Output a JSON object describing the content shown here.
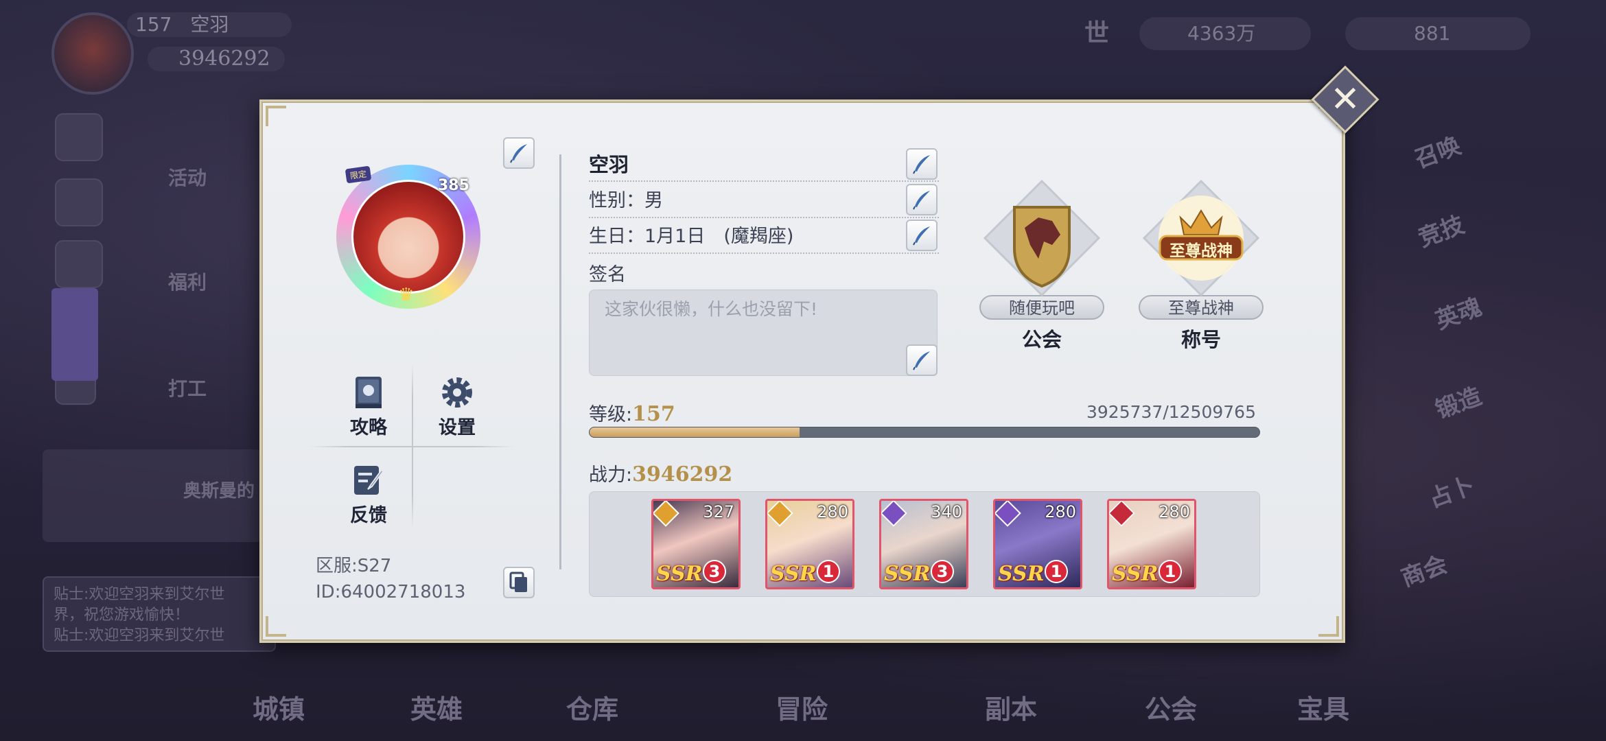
{
  "background": {
    "player_level": "157",
    "player_name": "空羽",
    "player_power": "3946292",
    "currency_gold": "4363万",
    "currency_gems": "881",
    "world_label": "世",
    "left_menu": [
      "活动",
      "福利",
      "打工"
    ],
    "right_menu": [
      "召唤",
      "竞技",
      "英魂",
      "锻造",
      "占卜",
      "商会"
    ],
    "bottom_nav": [
      "城镇",
      "英雄",
      "仓库",
      "冒险",
      "副本",
      "公会",
      "宝具"
    ],
    "notice_preview": "奥斯曼的",
    "chat_lines": [
      "贴士:欢迎空羽来到艾尔世",
      "界，祝您游戏愉快！",
      "贴士:欢迎空羽来到艾尔世"
    ]
  },
  "profile": {
    "avatar_level": "385",
    "avatar_tag": "限定",
    "name": "空羽",
    "gender": "性别：男",
    "birthday": "生日：1月1日　(魔羯座)",
    "signature_label": "签名",
    "signature_placeholder": "这家伙很懒，什么也没留下!",
    "menu": {
      "guide": "攻略",
      "settings": "设置",
      "feedback": "反馈"
    },
    "server": "区服:S27",
    "id": "ID:64002718013",
    "guild": {
      "name": "随便玩吧",
      "caption": "公会"
    },
    "title": {
      "name": "至尊战神",
      "caption": "称号",
      "emblem_text": "至尊战神"
    },
    "level_label": "等级:",
    "level": "157",
    "exp_text": "3925737/12509765",
    "exp_fraction": 0.3138,
    "power_label": "战力:",
    "power": "3946292",
    "team": [
      {
        "level": "327",
        "rarity": "SSR",
        "stars": "3",
        "element": "gold",
        "art": "dark"
      },
      {
        "level": "280",
        "rarity": "SSR",
        "stars": "1",
        "element": "gold",
        "art": "blonde"
      },
      {
        "level": "340",
        "rarity": "SSR",
        "stars": "3",
        "element": "purple",
        "art": "silver"
      },
      {
        "level": "280",
        "rarity": "SSR",
        "stars": "1",
        "element": "purple",
        "art": "violet"
      },
      {
        "level": "280",
        "rarity": "SSR",
        "stars": "1",
        "element": "red",
        "art": "pale"
      }
    ],
    "colors": {
      "accent_gold": "#b4904a",
      "exp_fill": "#c99d5e",
      "hero_border": "#e0556a"
    }
  }
}
